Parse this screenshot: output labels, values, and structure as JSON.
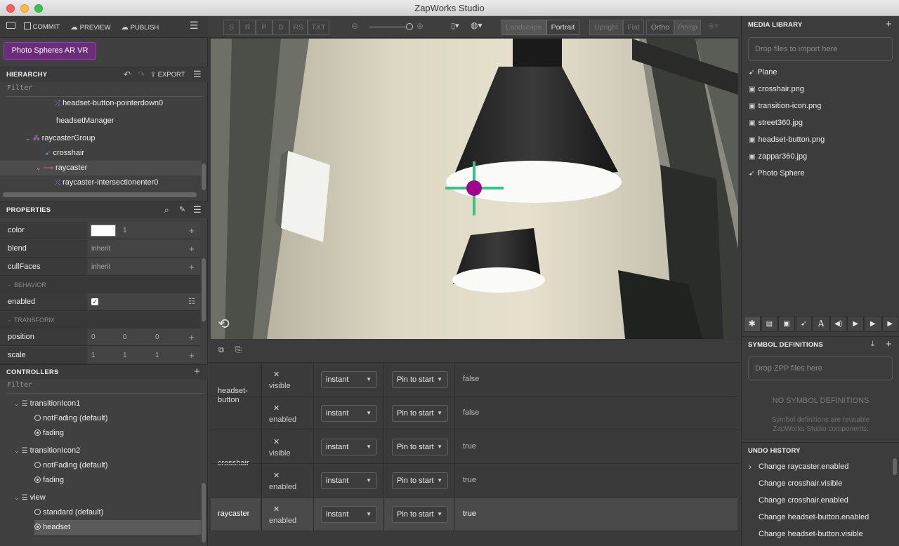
{
  "window": {
    "title": "ZapWorks Studio"
  },
  "toolbar": {
    "commit": "COMMIT",
    "preview": "PREVIEW",
    "publish": "PUBLISH",
    "project_name": "Photo Spheres AR VR",
    "transform_modes": [
      "S",
      "R",
      "P",
      "B",
      "RS",
      "TXT"
    ],
    "orientation": [
      "Landscape",
      "Portrait"
    ],
    "view_modes": [
      "Upright",
      "Flat"
    ],
    "camera_modes": [
      "Ortho",
      "Persp"
    ],
    "zoom_level": 1.0
  },
  "hierarchy": {
    "title": "HIERARCHY",
    "export": "EXPORT",
    "filter": "Filter",
    "items": [
      {
        "label": "headset-button-pointerdown0"
      },
      {
        "label": "headsetManager"
      },
      {
        "label": "raycasterGroup"
      },
      {
        "label": "crosshair"
      },
      {
        "label": "raycaster"
      },
      {
        "label": "raycaster-intersectionenter0"
      }
    ]
  },
  "properties": {
    "title": "PROPERTIES",
    "color": {
      "name": "color",
      "value": "1",
      "swatch": "#ffffff"
    },
    "blend": {
      "name": "blend",
      "value": "inherit"
    },
    "cullFaces": {
      "name": "cullFaces",
      "value": "inherit"
    },
    "behavior_label": "BEHAVIOR",
    "enabled": {
      "name": "enabled"
    },
    "transform_label": "TRANSFORM",
    "position": {
      "name": "position",
      "values": [
        "0",
        "0",
        "0"
      ]
    },
    "scale": {
      "name": "scale",
      "values": [
        "1",
        "1",
        "1"
      ]
    }
  },
  "controllers": {
    "title": "CONTROLLERS",
    "filter": "Filter",
    "groups": [
      {
        "name": "transitionIcon1",
        "states": [
          "notFading (default)",
          "fading"
        ]
      },
      {
        "name": "transitionIcon2",
        "states": [
          "notFading (default)",
          "fading"
        ]
      },
      {
        "name": "view",
        "states": [
          "standard (default)",
          "headset"
        ]
      }
    ]
  },
  "timeline": {
    "rows": [
      {
        "node": "headset-\nbutton",
        "prop": "visible",
        "transition": "instant",
        "pin": "Pin to start",
        "value": "false"
      },
      {
        "node": "",
        "prop": "enabled",
        "transition": "instant",
        "pin": "Pin to start",
        "value": "false"
      },
      {
        "node": "crosshair",
        "prop": "visible",
        "transition": "instant",
        "pin": "Pin to start",
        "value": "true"
      },
      {
        "node": "",
        "prop": "enabled",
        "transition": "instant",
        "pin": "Pin to start",
        "value": "true"
      },
      {
        "node": "raycaster",
        "prop": "enabled",
        "transition": "instant",
        "pin": "Pin to start",
        "value": "true"
      }
    ]
  },
  "media_library": {
    "title": "MEDIA LIBRARY",
    "drop_hint": "Drop files to import here",
    "items": [
      {
        "label": "Plane",
        "icon": "rocket-icon"
      },
      {
        "label": "crosshair.png",
        "icon": "image-icon"
      },
      {
        "label": "transition-icon.png",
        "icon": "image-icon"
      },
      {
        "label": "street360.jpg",
        "icon": "image-icon"
      },
      {
        "label": "headset-button.png",
        "icon": "image-icon"
      },
      {
        "label": "zappar360.jpg",
        "icon": "image-icon"
      },
      {
        "label": "Photo Sphere",
        "icon": "rocket-icon"
      }
    ]
  },
  "symbol_definitions": {
    "title": "SYMBOL DEFINITIONS",
    "drop_hint": "Drop ZPP files here",
    "empty_title": "NO SYMBOL DEFINITIONS",
    "empty_desc": "Symbol definitions are reusable ZapWorks Studio components."
  },
  "undo_history": {
    "title": "UNDO HISTORY",
    "items": [
      "Change raycaster.enabled",
      "Change crosshair.visible",
      "Change crosshair.enabled",
      "Change headset-button.enabled",
      "Change headset-button.visible"
    ]
  },
  "colors": {
    "accent_purple": "#6b2d7a",
    "crosshair_green": "#3dbf88",
    "crosshair_dot": "#a0008c"
  }
}
